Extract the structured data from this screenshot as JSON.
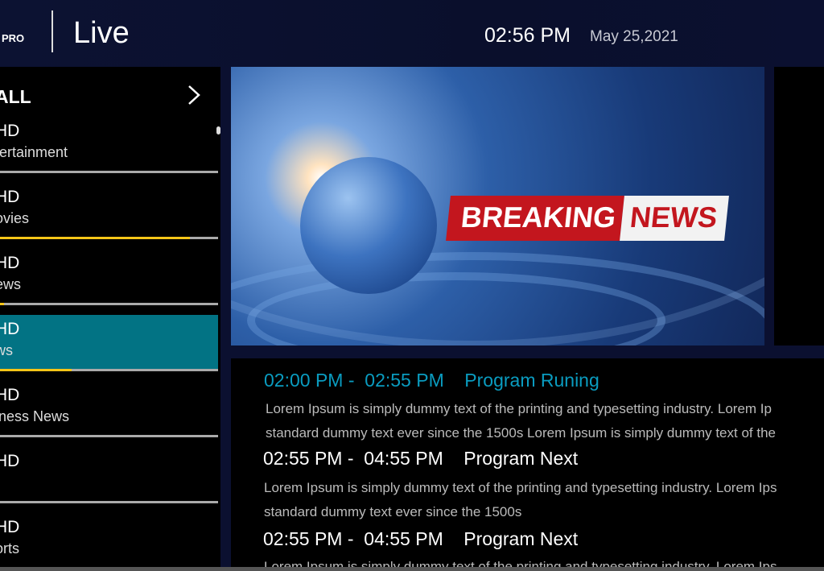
{
  "header": {
    "logo": "PRO",
    "title": "Live",
    "time": "02:56 PM",
    "date": "May 25,2021"
  },
  "sidebar": {
    "category": "ALL",
    "items": [
      {
        "name": "HD",
        "genre": "tertainment",
        "progress": 0,
        "selected": false
      },
      {
        "name": "HD",
        "genre": "ovies",
        "progress": 87,
        "selected": false
      },
      {
        "name": "HD",
        "genre": "ews",
        "progress": 2,
        "selected": false
      },
      {
        "name": "HD",
        "genre": "ws",
        "progress": 33,
        "selected": true
      },
      {
        "name": "HD",
        "genre": "iness News",
        "progress": 0,
        "selected": false
      },
      {
        "name": "HD",
        "genre": "",
        "progress": 0,
        "selected": false
      },
      {
        "name": "HD",
        "genre": "orts",
        "progress": 0,
        "selected": false
      }
    ]
  },
  "player": {
    "banner_left": "BREAKING",
    "banner_right": "NEWS"
  },
  "programs": [
    {
      "start": "02:00 PM -",
      "end": "02:55 PM",
      "title": "Program Runing",
      "lines": [
        "Lorem Ipsum is simply dummy text of the printing and typesetting industry. Lorem Ip",
        "standard dummy text ever since the 1500s Lorem Ipsum is simply dummy text of the"
      ]
    },
    {
      "start": "02:55 PM -",
      "end": "04:55 PM",
      "title": "Program Next",
      "lines": [
        "Lorem Ipsum is simply dummy text of the printing and typesetting industry. Lorem Ips",
        "standard dummy text ever since the 1500s"
      ]
    },
    {
      "start": "02:55 PM -",
      "end": "04:55 PM",
      "title": "Program Next",
      "lines": [
        "Lorem Ipsum is simply dummy text of the printing and typesetting industry. Lorem Ips"
      ]
    }
  ],
  "colors": {
    "accent": "#0a9cc0",
    "selected": "#027384",
    "progress": "#f5c518"
  }
}
